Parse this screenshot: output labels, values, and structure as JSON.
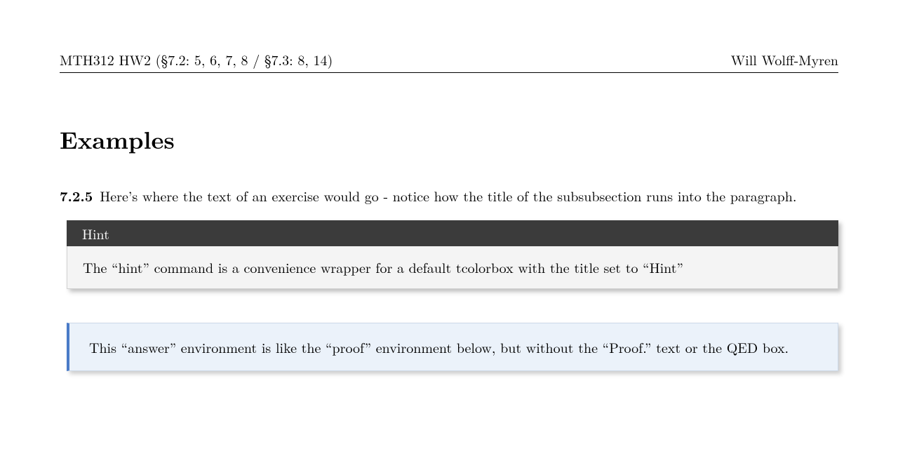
{
  "header": {
    "left": "MTH312 HW2 (§7.2: 5, 6, 7, 8 / §7.3: 8, 14)",
    "right": "Will Wolff-Myren"
  },
  "section": {
    "title": "Examples"
  },
  "exercise": {
    "number": "7.2.5",
    "text": "Here’s where the text of an exercise would go - notice how the title of the subsubsection runs into the paragraph."
  },
  "hint": {
    "title": "Hint",
    "body": "The “hint” command is a convenience wrapper for a default tcolorbox with the title set to “Hint”"
  },
  "answer": {
    "body": "This “answer” environment is like the “proof” environment below, but without the “Proof.” text or the QED box."
  }
}
